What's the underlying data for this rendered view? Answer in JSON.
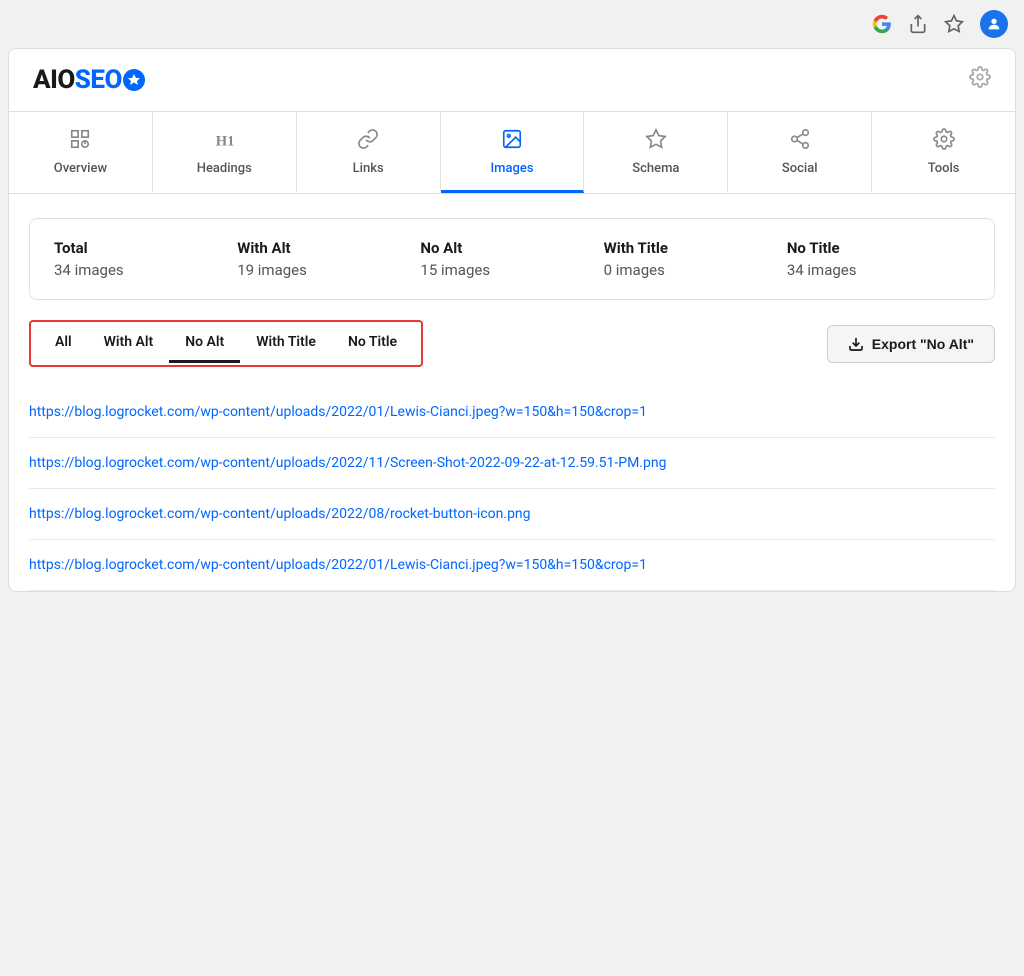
{
  "browser": {
    "profile_initial": "⚙"
  },
  "header": {
    "logo_aio": "AIO",
    "logo_seo": "SEO",
    "gear_label": "⚙"
  },
  "nav": {
    "tabs": [
      {
        "id": "overview",
        "label": "Overview",
        "icon": "overview"
      },
      {
        "id": "headings",
        "label": "Headings",
        "icon": "headings"
      },
      {
        "id": "links",
        "label": "Links",
        "icon": "links"
      },
      {
        "id": "images",
        "label": "Images",
        "icon": "images",
        "active": true
      },
      {
        "id": "schema",
        "label": "Schema",
        "icon": "schema"
      },
      {
        "id": "social",
        "label": "Social",
        "icon": "social"
      },
      {
        "id": "tools",
        "label": "Tools",
        "icon": "tools"
      }
    ]
  },
  "stats": [
    {
      "label": "Total",
      "value": "34 images"
    },
    {
      "label": "With Alt",
      "value": "19 images"
    },
    {
      "label": "No Alt",
      "value": "15 images"
    },
    {
      "label": "With Title",
      "value": "0 images"
    },
    {
      "label": "No Title",
      "value": "34 images"
    }
  ],
  "filter_tabs": [
    {
      "id": "all",
      "label": "All"
    },
    {
      "id": "with-alt",
      "label": "With Alt"
    },
    {
      "id": "no-alt",
      "label": "No Alt",
      "active": true
    },
    {
      "id": "with-title",
      "label": "With Title"
    },
    {
      "id": "no-title",
      "label": "No Title"
    }
  ],
  "export_button": "Export \"No Alt\"",
  "image_links": [
    "https://blog.logrocket.com/wp-content/uploads/2022/01/Lewis-Cianci.jpeg?w=150&h=150&crop=1",
    "https://blog.logrocket.com/wp-content/uploads/2022/11/Screen-Shot-2022-09-22-at-12.59.51-PM.png",
    "https://blog.logrocket.com/wp-content/uploads/2022/08/rocket-button-icon.png",
    "https://blog.logrocket.com/wp-content/uploads/2022/01/Lewis-Cianci.jpeg?w=150&h=150&crop=1"
  ]
}
